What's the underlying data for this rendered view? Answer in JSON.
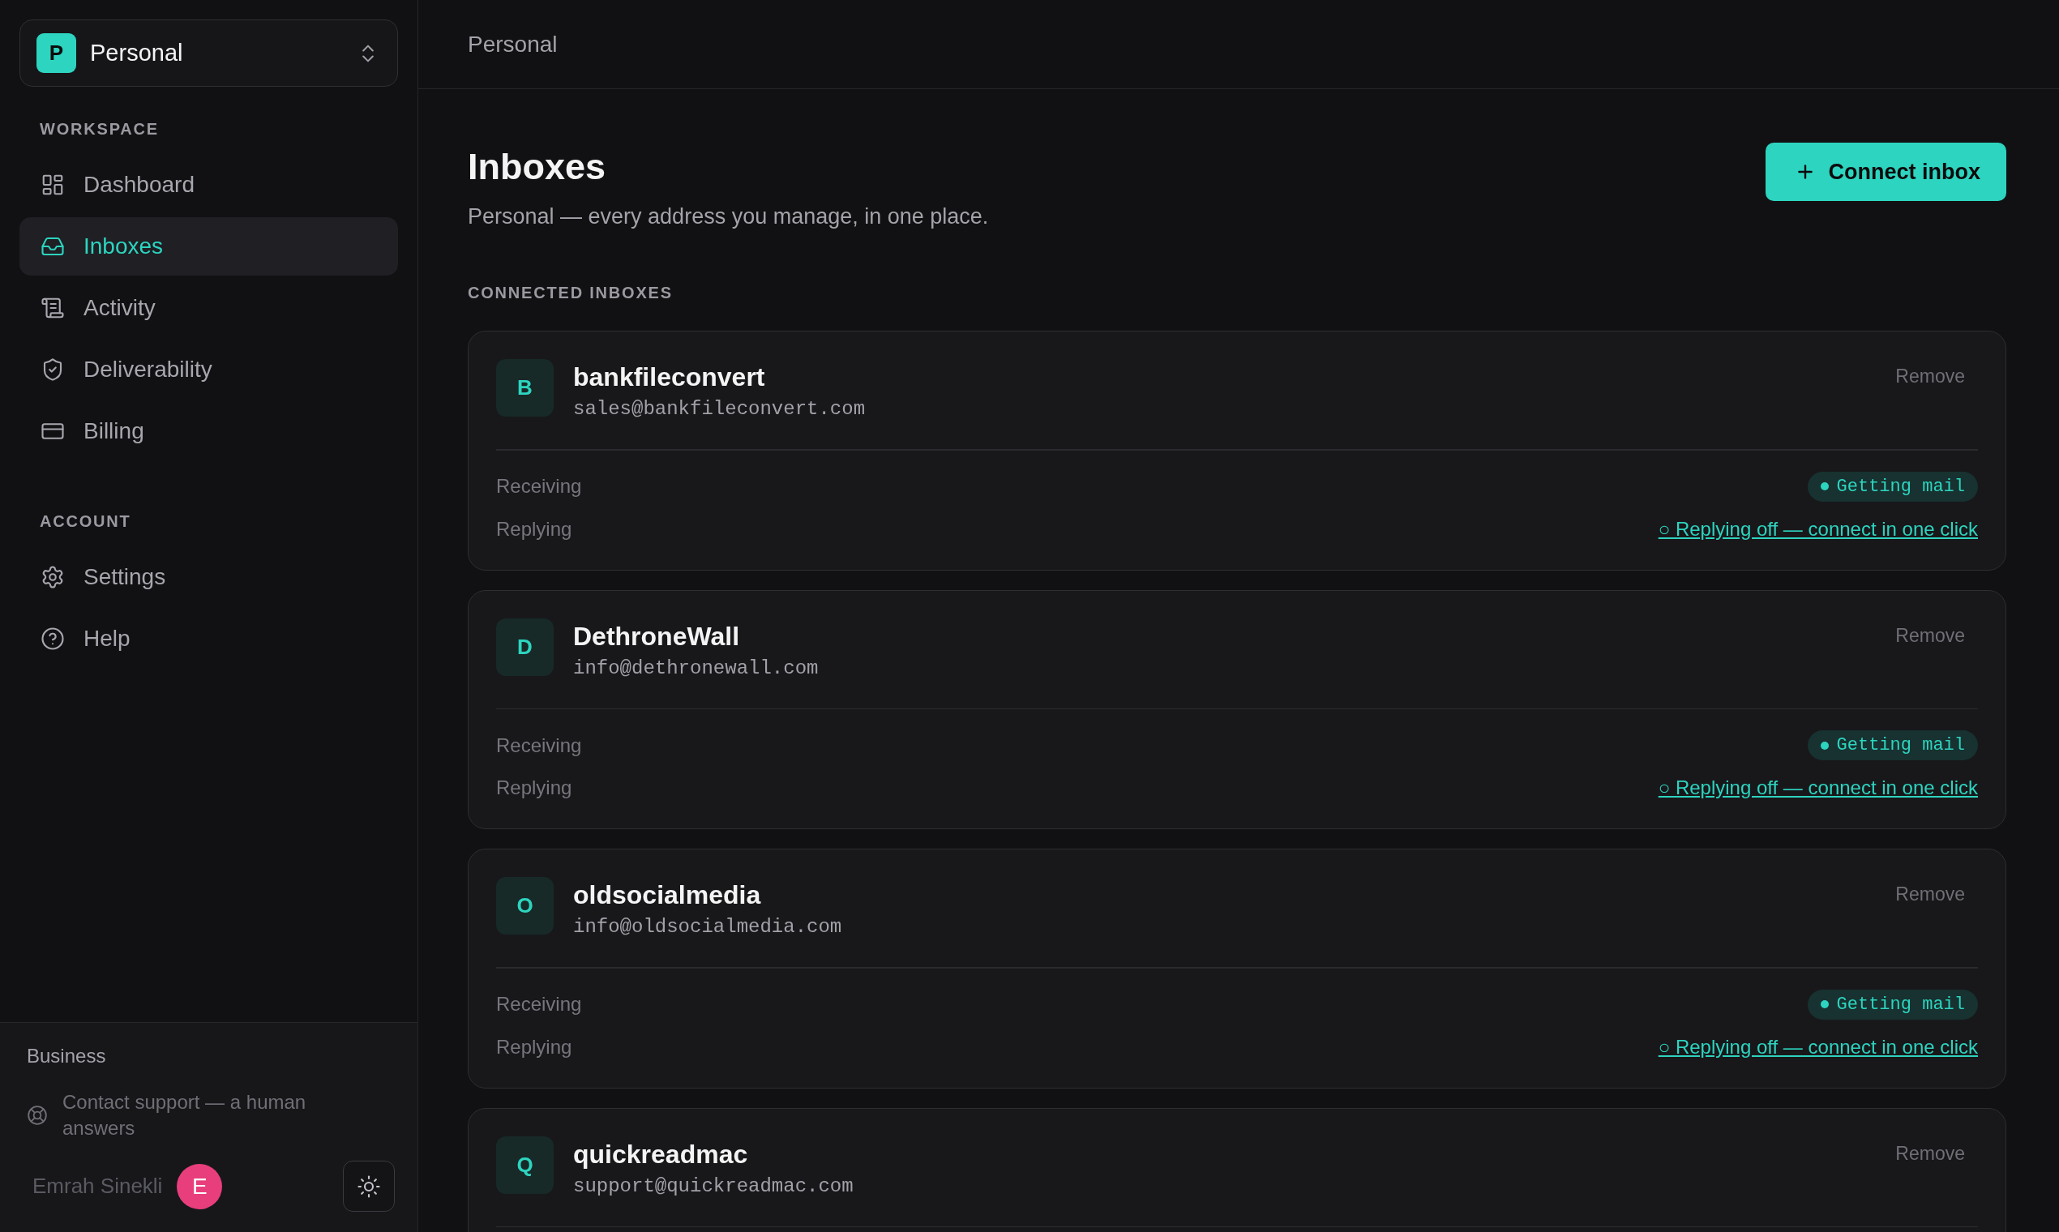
{
  "sidebar": {
    "workspace_switcher": {
      "initial": "P",
      "name": "Personal"
    },
    "sections": [
      {
        "heading": "WORKSPACE",
        "items": [
          {
            "label": "Dashboard",
            "kind": "dashboard",
            "selected": false
          },
          {
            "label": "Inboxes",
            "kind": "inboxes",
            "selected": true
          },
          {
            "label": "Activity",
            "kind": "activity",
            "selected": false
          },
          {
            "label": "Deliverability",
            "kind": "deliverability",
            "selected": false
          },
          {
            "label": "Billing",
            "kind": "billing",
            "selected": false
          }
        ]
      },
      {
        "heading": "ACCOUNT",
        "items": [
          {
            "label": "Settings",
            "kind": "settings",
            "selected": false
          },
          {
            "label": "Help",
            "kind": "help",
            "selected": false
          }
        ]
      }
    ],
    "footer": {
      "plan": "Business",
      "support_link": "Contact support — a human answers",
      "user_name": "Emrah Sinekli",
      "avatar_initial": "E"
    }
  },
  "header": {
    "breadcrumb": "Personal"
  },
  "page": {
    "title": "Inboxes",
    "subtitle": "Personal — every address you manage, in one place.",
    "connect_button": "Connect inbox",
    "section_heading": "CONNECTED INBOXES"
  },
  "inboxes": [
    {
      "initial": "B",
      "name": "bankfileconvert",
      "email": "sales@bankfileconvert.com",
      "remove": "Remove",
      "rows": [
        {
          "label": "Receiving",
          "kind": "status",
          "value": "Getting mail"
        },
        {
          "label": "Replying",
          "kind": "link",
          "value": "○ Replying off — connect in one click"
        }
      ]
    },
    {
      "initial": "D",
      "name": "DethroneWall",
      "email": "info@dethronewall.com",
      "remove": "Remove",
      "rows": [
        {
          "label": "Receiving",
          "kind": "status",
          "value": "Getting mail"
        },
        {
          "label": "Replying",
          "kind": "link",
          "value": "○ Replying off — connect in one click"
        }
      ]
    },
    {
      "initial": "O",
      "name": "oldsocialmedia",
      "email": "info@oldsocialmedia.com",
      "remove": "Remove",
      "rows": [
        {
          "label": "Receiving",
          "kind": "status",
          "value": "Getting mail"
        },
        {
          "label": "Replying",
          "kind": "link",
          "value": "○ Replying off — connect in one click"
        }
      ]
    },
    {
      "initial": "Q",
      "name": "quickreadmac",
      "email": "support@quickreadmac.com",
      "remove": "Remove"
    }
  ]
}
